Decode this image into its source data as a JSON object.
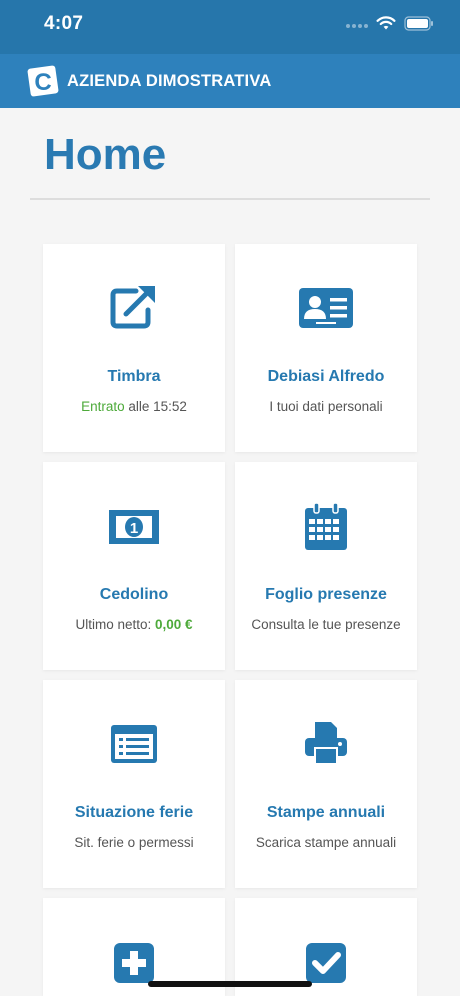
{
  "status_bar": {
    "time": "4:07",
    "icons": [
      "signal-icon",
      "wifi-icon",
      "battery-icon"
    ]
  },
  "app_bar": {
    "logo_letter": "C",
    "company_name": "AZIENDA DIMOSTRATIVA"
  },
  "page": {
    "title": "Home"
  },
  "colors": {
    "primary": "#2e81bc",
    "status": "#2676ab",
    "accent_green": "#4daa3a",
    "title_blue": "#2a7ab2"
  },
  "tiles": [
    {
      "icon": "external-link-icon",
      "title": "Timbra",
      "status_word": "Entrato",
      "status_rest": " alle 15:52"
    },
    {
      "icon": "id-card-icon",
      "title": "Debiasi Alfredo",
      "subtitle": "I tuoi dati personali"
    },
    {
      "icon": "banknote-icon",
      "title": "Cedolino",
      "subtitle_prefix": "Ultimo netto: ",
      "amount": "0,00 €"
    },
    {
      "icon": "calendar-icon",
      "title": "Foglio presenze",
      "subtitle": "Consulta le tue presenze"
    },
    {
      "icon": "list-icon",
      "title": "Situazione ferie",
      "subtitle": "Sit. ferie o permessi"
    },
    {
      "icon": "printer-icon",
      "title": "Stampe annuali",
      "subtitle": "Scarica stampe annuali"
    },
    {
      "icon": "plus-square-icon"
    },
    {
      "icon": "check-square-icon"
    }
  ]
}
